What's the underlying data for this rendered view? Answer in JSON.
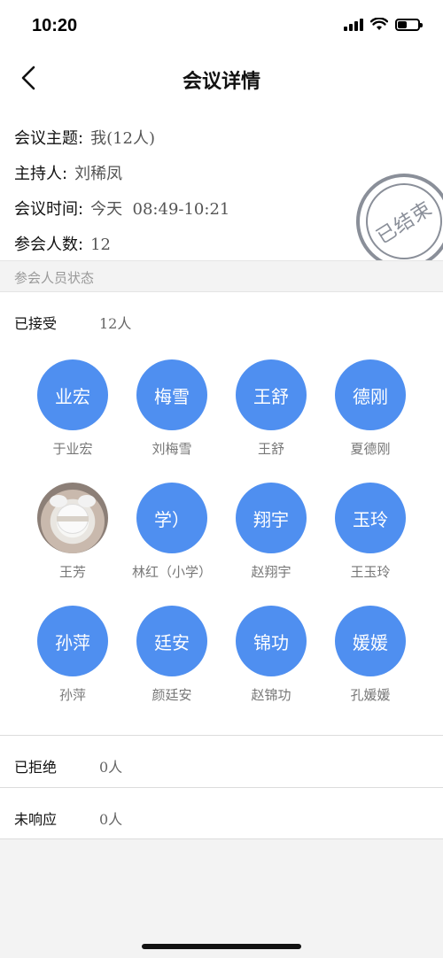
{
  "status_bar": {
    "time": "10:20",
    "battery_level": 0.45
  },
  "nav": {
    "title": "会议详情"
  },
  "info": {
    "topic_label": "会议主题:",
    "topic_value": "我(12人)",
    "host_label": "主持人:",
    "host_value": "刘稀凤",
    "time_label": "会议时间:",
    "time_value": "今天  08:49-10:21",
    "count_label": "参会人数:",
    "count_value": "12",
    "stamp_text": "已结束"
  },
  "section": {
    "title": "参会人员状态"
  },
  "groups": {
    "accepted": {
      "label": "已接受",
      "count": "12人"
    },
    "rejected": {
      "label": "已拒绝",
      "count": "0人"
    },
    "no_response": {
      "label": "未响应",
      "count": "0人"
    }
  },
  "people": [
    {
      "avatar": "业宏",
      "name": "于业宏"
    },
    {
      "avatar": "梅雪",
      "name": "刘梅雪"
    },
    {
      "avatar": "王舒",
      "name": "王舒"
    },
    {
      "avatar": "德刚",
      "name": "夏德刚"
    },
    {
      "avatar": "",
      "name": "王芳",
      "photo": true
    },
    {
      "avatar": "学）",
      "name": "林红（小学）"
    },
    {
      "avatar": "翔宇",
      "name": "赵翔宇"
    },
    {
      "avatar": "玉玲",
      "name": "王玉玲"
    },
    {
      "avatar": "孙萍",
      "name": "孙萍"
    },
    {
      "avatar": "廷安",
      "name": "颜廷安"
    },
    {
      "avatar": "锦功",
      "name": "赵锦功"
    },
    {
      "avatar": "媛媛",
      "name": "孔媛媛"
    }
  ],
  "colors": {
    "avatar_bg": "#4f8ff0",
    "stamp": "#8a8f99"
  }
}
